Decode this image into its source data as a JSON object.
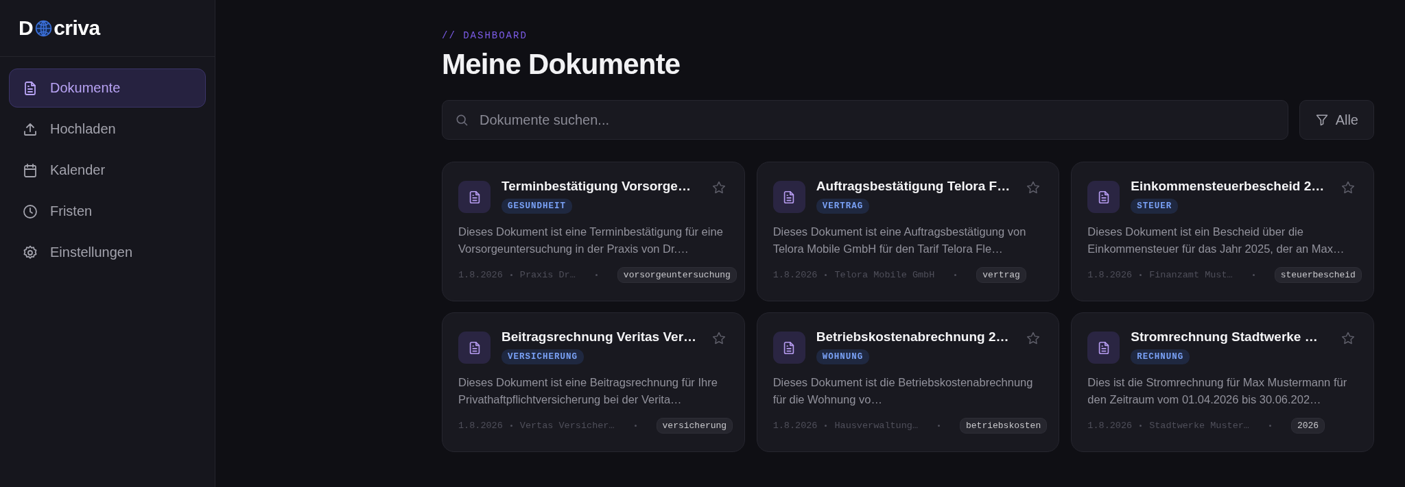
{
  "logo": {
    "left": "D",
    "right": "criva"
  },
  "sidebar": {
    "items": [
      {
        "label": "Dokumente",
        "kind": "documents",
        "selected": true
      },
      {
        "label": "Hochladen",
        "kind": "upload",
        "selected": false
      },
      {
        "label": "Kalender",
        "kind": "calendar",
        "selected": false
      },
      {
        "label": "Fristen",
        "kind": "clock",
        "selected": false
      },
      {
        "label": "Einstellungen",
        "kind": "settings",
        "selected": false
      }
    ]
  },
  "header": {
    "eyebrow": "// DASHBOARD",
    "title": "Meine Dokumente"
  },
  "search": {
    "placeholder": "Dokumente suchen..."
  },
  "filter": {
    "label": "Alle"
  },
  "documents": [
    {
      "title": "Terminbestätigung Vorsorge…",
      "category": "GESUNDHEIT",
      "favorite": false,
      "description": "Dieses Dokument ist eine Terminbestätigung für eine Vorsorgeuntersuchung in der Praxis von Dr.…",
      "date": "1.8.2026",
      "source": "Praxis Dr…",
      "tag": "vorsorgeuntersuchung"
    },
    {
      "title": "Auftragsbestätigung Telora F…",
      "category": "VERTRAG",
      "favorite": false,
      "description": "Dieses Dokument ist eine Auftragsbestätigung von Telora Mobile GmbH für den Tarif Telora Fle…",
      "date": "1.8.2026",
      "source": "Telora Mobile GmbH",
      "tag": "vertrag"
    },
    {
      "title": "Einkommensteuerbescheid 2…",
      "category": "STEUER",
      "favorite": false,
      "description": "Dieses Dokument ist ein Bescheid über die Einkommensteuer für das Jahr 2025, der an Max…",
      "date": "1.8.2026",
      "source": "Finanzamt Must…",
      "tag": "steuerbescheid"
    },
    {
      "title": "Beitragsrechnung Veritas Ver…",
      "category": "VERSICHERUNG",
      "favorite": false,
      "description": "Dieses Dokument ist eine Beitragsrechnung für Ihre Privathaftpflichtversicherung bei der Verita…",
      "date": "1.8.2026",
      "source": "Vertas Versicher…",
      "tag": "versicherung"
    },
    {
      "title": "Betriebskostenabrechnung 2…",
      "category": "WOHNUNG",
      "favorite": false,
      "description": "Dieses Dokument ist die Betriebskostenabrechnung für die Wohnung vo…",
      "date": "1.8.2026",
      "source": "Hausverwaltung…",
      "tag": "betriebskosten"
    },
    {
      "title": "Stromrechnung Stadtwerke …",
      "category": "RECHNUNG",
      "favorite": false,
      "description": "Dies ist die Stromrechnung für Max Mustermann für den Zeitraum vom 01.04.2026 bis 30.06.202…",
      "date": "1.8.2026",
      "source": "Stadtwerke Muster…",
      "tag": "2026"
    }
  ]
}
